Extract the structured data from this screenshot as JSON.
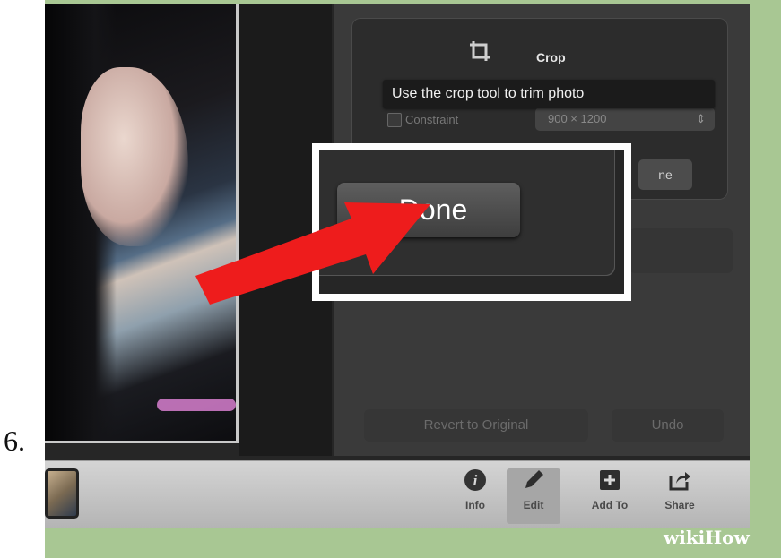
{
  "step": {
    "number": "6."
  },
  "crop_panel": {
    "title": "Crop",
    "icon": "crop-icon",
    "tooltip": "Use the crop tool to trim photo",
    "constraint_label": "Constraint",
    "size_value": "900 × 1200",
    "done_small_label": "ne"
  },
  "highlight": {
    "done_label": "Done"
  },
  "bottom_actions": {
    "revert_label": "Revert to Original",
    "undo_label": "Undo"
  },
  "toolbar": {
    "items": [
      {
        "label": "Info",
        "icon": "info-icon"
      },
      {
        "label": "Edit",
        "icon": "pencil-icon",
        "active": true
      },
      {
        "label": "Add To",
        "icon": "plus-icon"
      },
      {
        "label": "Share",
        "icon": "share-icon"
      }
    ]
  },
  "watermark": {
    "wiki": "wiki",
    "how": "How"
  },
  "colors": {
    "frame_green": "#a8c793",
    "arrow_red": "#ee1c1c",
    "panel_dark": "#3a3a3a"
  }
}
